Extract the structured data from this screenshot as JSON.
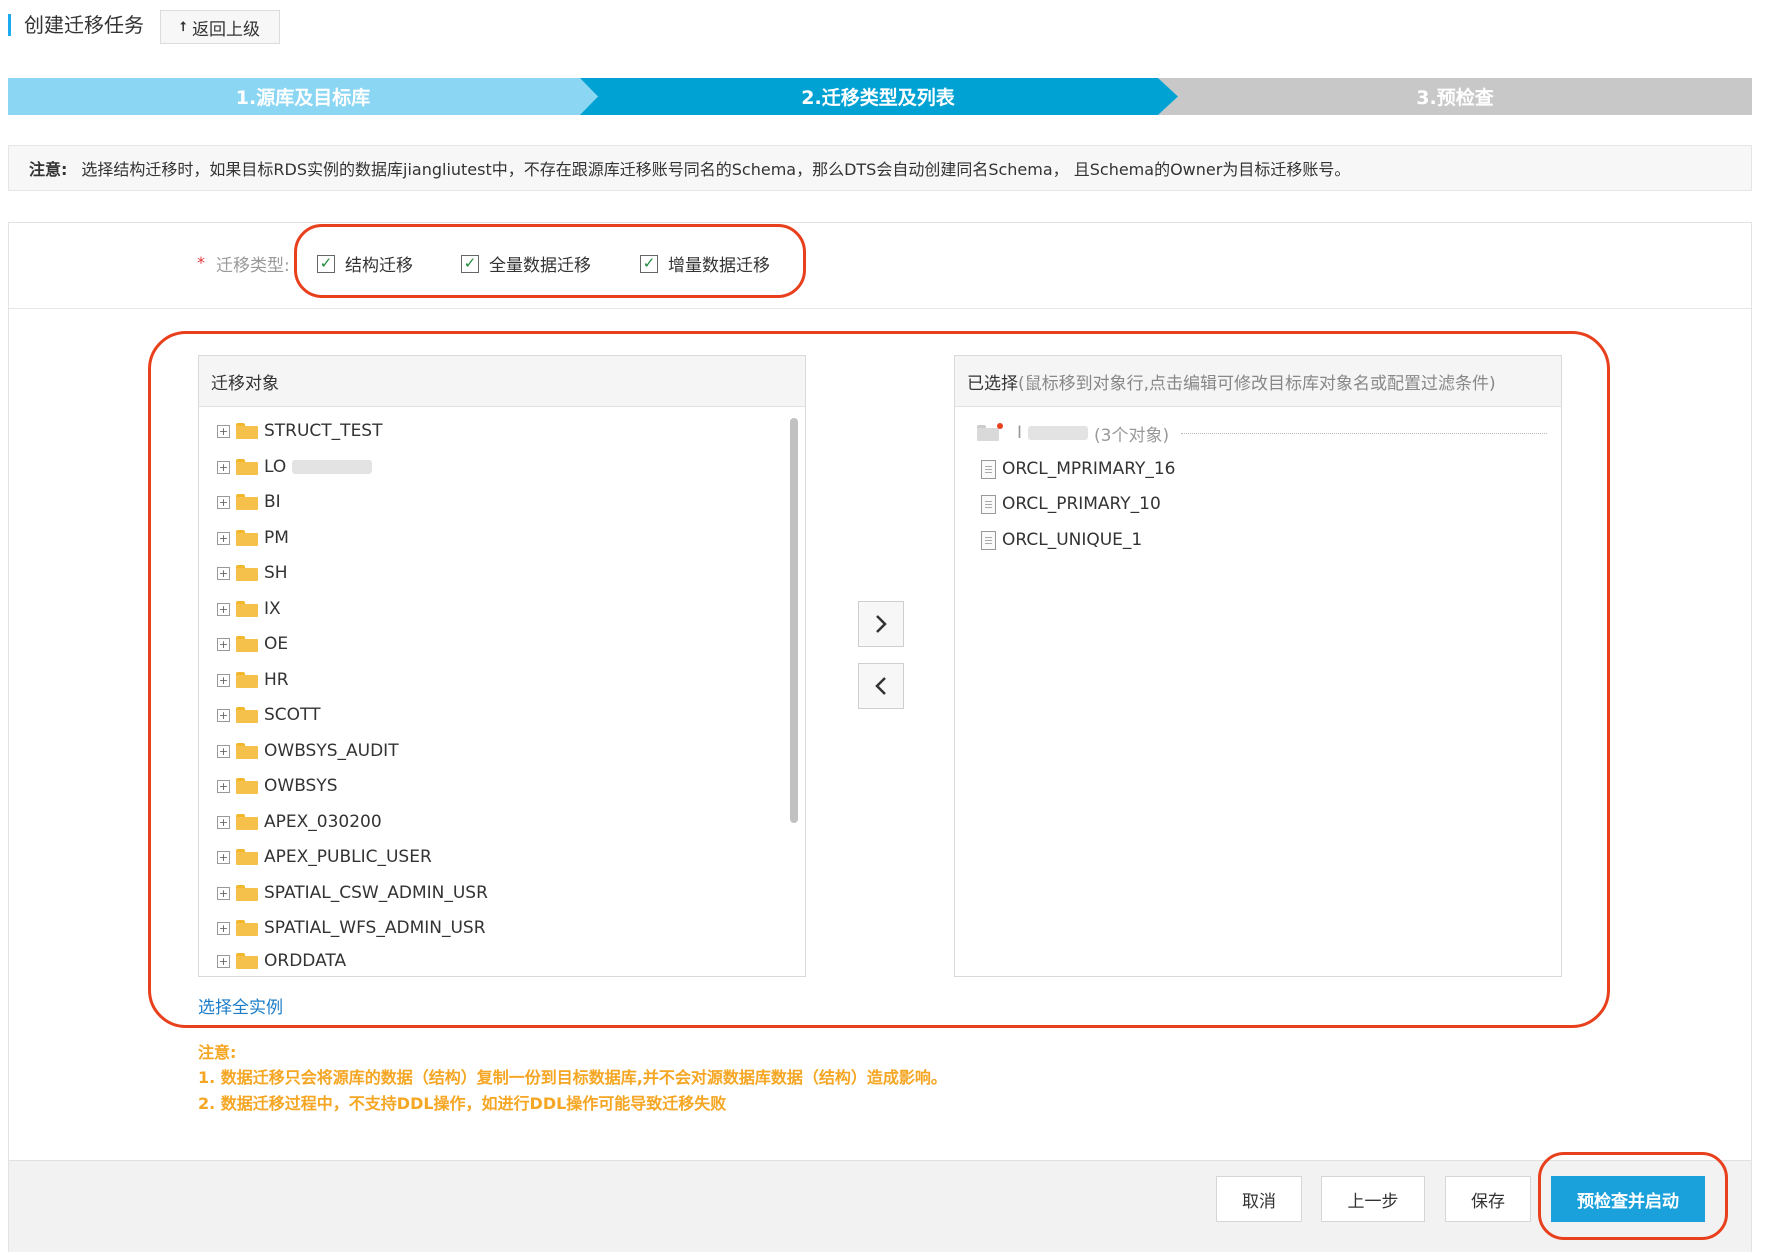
{
  "header": {
    "title": "创建迁移任务",
    "back_button": "返回上级"
  },
  "steps": [
    {
      "label": "1.源库及目标库",
      "state": "done"
    },
    {
      "label": "2.迁移类型及列表",
      "state": "active"
    },
    {
      "label": "3.预检查",
      "state": "pending"
    }
  ],
  "notice": {
    "prefix": "注意:",
    "text": "选择结构迁移时，如果目标RDS实例的数据库jiangliutest中，不存在跟源库迁移账号同名的Schema，那么DTS会自动创建同名Schema， 且Schema的Owner为目标迁移账号。"
  },
  "migration_type": {
    "label": "迁移类型:",
    "options": [
      {
        "label": "结构迁移",
        "checked": true
      },
      {
        "label": "全量数据迁移",
        "checked": true
      },
      {
        "label": "增量数据迁移",
        "checked": true
      }
    ]
  },
  "source_panel": {
    "title": "迁移对象",
    "items": [
      "STRUCT_TEST",
      "LO",
      "BI",
      "PM",
      "SH",
      "IX",
      "OE",
      "HR",
      "SCOTT",
      "OWBSYS_AUDIT",
      "OWBSYS",
      "APEX_030200",
      "APEX_PUBLIC_USER",
      "SPATIAL_CSW_ADMIN_USR",
      "SPATIAL_WFS_ADMIN_USR",
      "ORDDATA"
    ]
  },
  "selected_panel": {
    "title": "已选择",
    "hint": "(鼠标移到对象行,点击编辑可修改目标库对象名或配置过滤条件)",
    "group_prefix": "I",
    "group_count": "(3个对象)",
    "items": [
      "ORCL_MPRIMARY_16",
      "ORCL_PRIMARY_10",
      "ORCL_UNIQUE_1"
    ]
  },
  "select_all_link": "选择全实例",
  "warning": {
    "title": "注意:",
    "lines": [
      "1. 数据迁移只会将源库的数据（结构）复制一份到目标数据库,并不会对源数据库数据（结构）造成影响。",
      "2. 数据迁移过程中，不支持DDL操作，如进行DDL操作可能导致迁移失败"
    ]
  },
  "footer": {
    "cancel": "取消",
    "prev": "上一步",
    "save": "保存",
    "precheck_start": "预检查并启动"
  },
  "colors": {
    "accent": "#00a2d4",
    "step_done": "#8bd6f2",
    "step_pending": "#c8c8c8",
    "highlight": "#e8401c",
    "warning": "#f5a623",
    "primary_button": "#1aa1db",
    "link": "#1c7cc7"
  }
}
